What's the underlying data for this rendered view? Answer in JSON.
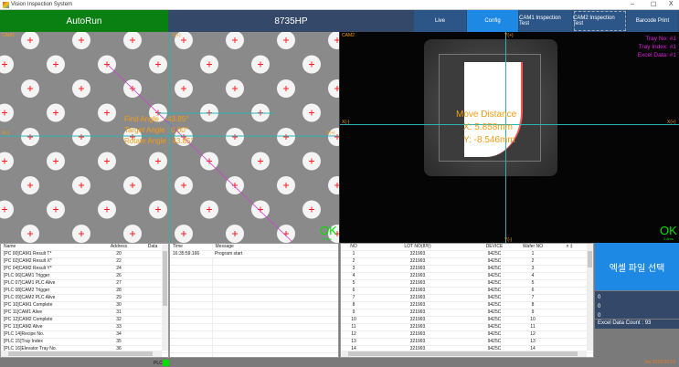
{
  "window": {
    "title": "Vision Inspection System",
    "min": "–",
    "max": "☐",
    "close": "X"
  },
  "header": {
    "mode": "AutoRun",
    "model": "8735HP",
    "buttons": [
      "Live",
      "Config",
      "CAM1 Inspection Test",
      "CAM2 Inspection Test",
      "Barcode Print"
    ],
    "colors": {
      "mode": "#0a7f12",
      "model": "#34496a",
      "button": "#2d5688",
      "active": "#1e88e5"
    }
  },
  "cam1": {
    "label": "CAM1",
    "y_plus": "Y(+)",
    "x_minus": "X(-)",
    "x_plus": "X(+)",
    "find_angle": "Find Angle : -43.85°",
    "target_angle": "Target Angle : 0.00°",
    "rotate_angle": "Rotate Angle : 43.85°",
    "result": "OK",
    "time": "3.0ms"
  },
  "cam2": {
    "label": "CAM2",
    "y_plus": "Y(+)",
    "y_minus": "Y(-)",
    "x_minus": "X(-)",
    "x_plus": "X(+)",
    "tray_no": "Tray No: #1",
    "tray_index": "Tray Index: #1",
    "excel_data": "Excel Data: #1",
    "move_title": "Move Distance",
    "move_x": "X: 5.858mm",
    "move_y": "Y: -8.546mm",
    "result": "OK",
    "time": "2.8ms"
  },
  "plc_table": {
    "columns": [
      "Name",
      "Address",
      "Data"
    ],
    "rows": [
      [
        "[PC 00]CAM1 Result T*",
        "20",
        ""
      ],
      [
        "[PC 02]CAM2 Result X*",
        "22",
        ""
      ],
      [
        "[PC 04]CAM2 Result Y*",
        "24",
        ""
      ],
      [
        "[PLC 06]CAM1 Trigger",
        "26",
        ""
      ],
      [
        "[PLC 07]CAM1 PLC Alive",
        "27",
        ""
      ],
      [
        "[PLC 08]CAM2 Trigger",
        "28",
        ""
      ],
      [
        "[PLC 09]CAM2 PLC Alive",
        "29",
        ""
      ],
      [
        "[PC 10]CAM1 Complete",
        "30",
        ""
      ],
      [
        "[PC 11]CAM1 Alive",
        "31",
        ""
      ],
      [
        "[PC 12]CAM2 Complete",
        "32",
        ""
      ],
      [
        "[PC 13]CAM2 Alive",
        "33",
        ""
      ],
      [
        "[PLC 14]Recipe No.",
        "34",
        ""
      ],
      [
        "[PLC 15]Tray Index",
        "35",
        ""
      ],
      [
        "[PLC 16]Elevator Tray No.",
        "36",
        ""
      ],
      [
        "[PLC 17]Printer Trigger",
        "37",
        ""
      ],
      [
        "[PLC 18]Printer Tray Index",
        "38",
        ""
      ]
    ]
  },
  "log": {
    "columns": [
      "Time",
      "Message"
    ],
    "rows": [
      [
        "16:35:59.166",
        "Program start"
      ]
    ]
  },
  "excel_table": {
    "columns": [
      "NO",
      "LOT NO(8자)",
      "DEVICE",
      "Wafer NO",
      "",
      ""
    ],
    "rows": [
      [
        "1",
        "321993",
        "9425C",
        "1"
      ],
      [
        "2",
        "321993",
        "9425C",
        "2"
      ],
      [
        "3",
        "321993",
        "9425C",
        "3"
      ],
      [
        "4",
        "321993",
        "9425C",
        "4"
      ],
      [
        "5",
        "321993",
        "9425C",
        "5"
      ],
      [
        "6",
        "321993",
        "9425C",
        "6"
      ],
      [
        "7",
        "321993",
        "9425C",
        "7"
      ],
      [
        "8",
        "321993",
        "9425C",
        "8"
      ],
      [
        "9",
        "321993",
        "9425C",
        "9"
      ],
      [
        "10",
        "321993",
        "9425C",
        "10"
      ],
      [
        "11",
        "321993",
        "9425C",
        "11"
      ],
      [
        "12",
        "321993",
        "9425C",
        "12"
      ],
      [
        "13",
        "321993",
        "9425C",
        "13"
      ],
      [
        "14",
        "321993",
        "9425C",
        "14"
      ],
      [
        "15",
        "321993",
        "9425C",
        "15"
      ],
      [
        "16",
        "321993",
        "9425C",
        "16"
      ]
    ]
  },
  "side": {
    "excel_button": "엑셀 파일 선택",
    "values": [
      "0",
      "0",
      "0"
    ],
    "excel_count": "Excel Data Count : 93"
  },
  "status": {
    "plc": "PLC",
    "plc_color": "#00e000",
    "version": "Ver 2023.09.13"
  }
}
